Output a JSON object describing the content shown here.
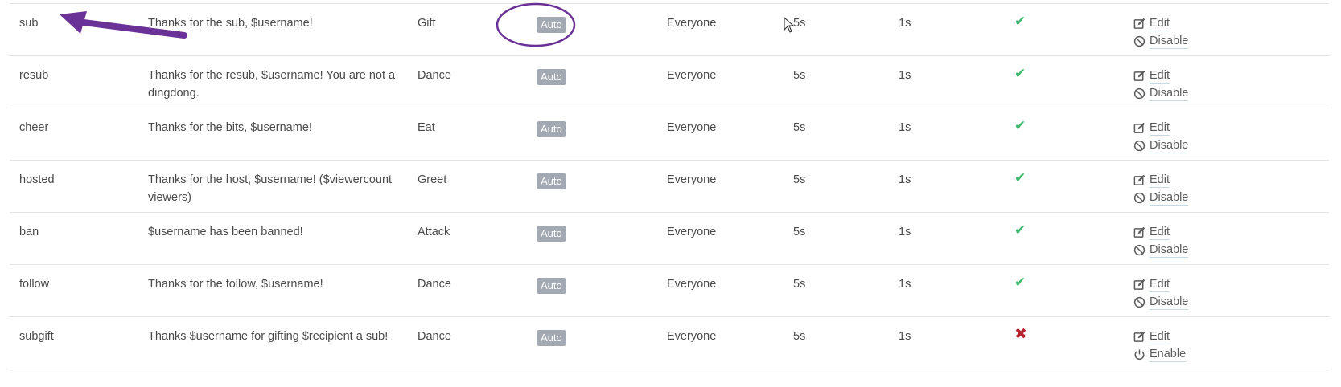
{
  "colors": {
    "badge_bg": "#a2a9b2",
    "enabled_check": "#3bb86b",
    "disabled_cross": "#b5242e",
    "annotation": "#6a3196"
  },
  "icons": {
    "edit": "edit-icon",
    "disable": "ban-icon",
    "enable": "power-icon",
    "enabled": "check-icon",
    "disabled": "close-icon"
  },
  "rows": [
    {
      "event": "sub",
      "message": "Thanks for the sub, $username!",
      "animation": "Gift",
      "badge": "Auto",
      "permission": "Everyone",
      "duration": "5s",
      "cooldown": "1s",
      "enabled": true,
      "edit_label": "Edit",
      "toggle_label": "Disable"
    },
    {
      "event": "resub",
      "message": "Thanks for the resub, $username! You are not a dingdong.",
      "animation": "Dance",
      "badge": "Auto",
      "permission": "Everyone",
      "duration": "5s",
      "cooldown": "1s",
      "enabled": true,
      "edit_label": "Edit",
      "toggle_label": "Disable"
    },
    {
      "event": "cheer",
      "message": "Thanks for the bits, $username!",
      "animation": "Eat",
      "badge": "Auto",
      "permission": "Everyone",
      "duration": "5s",
      "cooldown": "1s",
      "enabled": true,
      "edit_label": "Edit",
      "toggle_label": "Disable"
    },
    {
      "event": "hosted",
      "message": "Thanks for the host, $username! ($viewercount viewers)",
      "animation": "Greet",
      "badge": "Auto",
      "permission": "Everyone",
      "duration": "5s",
      "cooldown": "1s",
      "enabled": true,
      "edit_label": "Edit",
      "toggle_label": "Disable"
    },
    {
      "event": "ban",
      "message": "$username has been banned!",
      "animation": "Attack",
      "badge": "Auto",
      "permission": "Everyone",
      "duration": "5s",
      "cooldown": "1s",
      "enabled": true,
      "edit_label": "Edit",
      "toggle_label": "Disable"
    },
    {
      "event": "follow",
      "message": "Thanks for the follow, $username!",
      "animation": "Dance",
      "badge": "Auto",
      "permission": "Everyone",
      "duration": "5s",
      "cooldown": "1s",
      "enabled": true,
      "edit_label": "Edit",
      "toggle_label": "Disable"
    },
    {
      "event": "subgift",
      "message": "Thanks $username for gifting $recipient a sub!",
      "animation": "Dance",
      "badge": "Auto",
      "permission": "Everyone",
      "duration": "5s",
      "cooldown": "1s",
      "enabled": false,
      "edit_label": "Edit",
      "toggle_label": "Enable"
    }
  ]
}
